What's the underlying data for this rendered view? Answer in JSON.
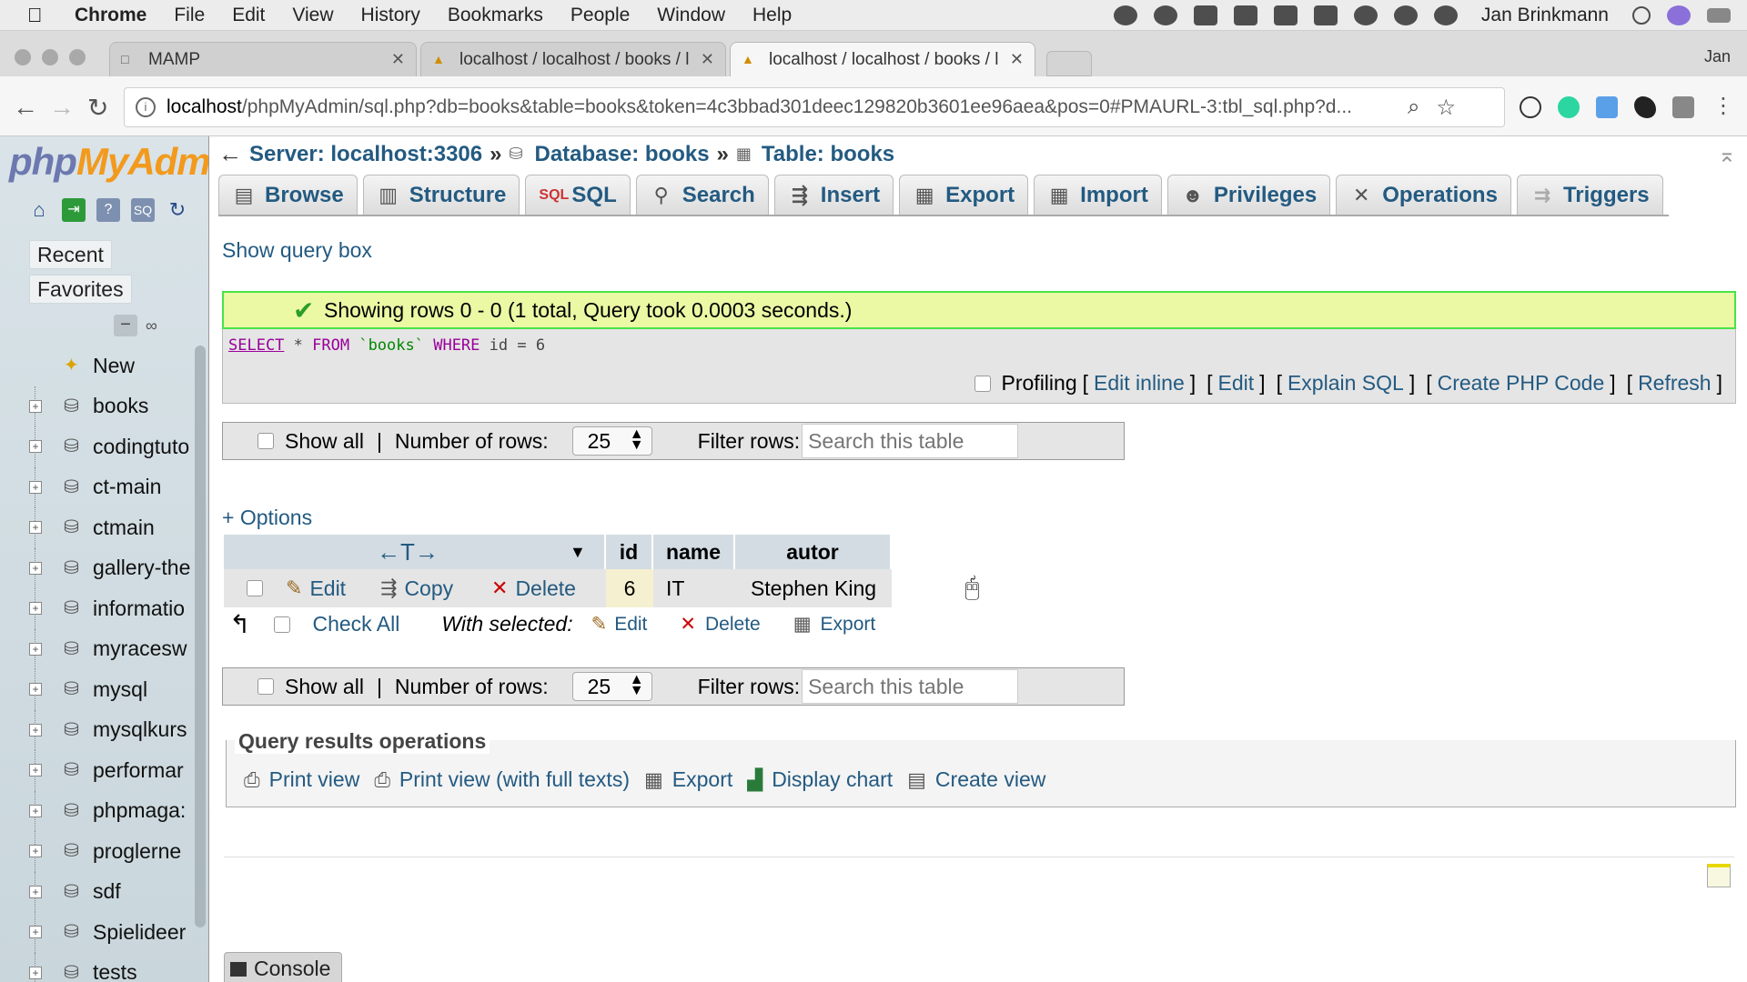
{
  "menubar": {
    "apple": "",
    "items": [
      "Chrome",
      "File",
      "Edit",
      "View",
      "History",
      "Bookmarks",
      "People",
      "Window",
      "Help"
    ],
    "user": "Jan Brinkmann"
  },
  "browser": {
    "tabs": [
      {
        "title": "MAMP",
        "active": false
      },
      {
        "title": "localhost / localhost / books / l",
        "active": false
      },
      {
        "title": "localhost / localhost / books / l",
        "active": true
      }
    ],
    "profile": "Jan",
    "url_host": "localhost",
    "url_path": "/phpMyAdmin/sql.php?db=books&table=books&token=4c3bbad301deec129820b3601ee96aea&pos=0#PMAURL-3:tbl_sql.php?d..."
  },
  "sidebar": {
    "logo_php": "php",
    "logo_my": "MyAdmi",
    "recent_label": "Recent",
    "favorites_label": "Favorites",
    "new_label": "New",
    "databases": [
      "books",
      "codingtuto",
      "ct-main",
      "ctmain",
      "gallery-the",
      "informatio",
      "myracesw",
      "mysql",
      "mysqlkurs",
      "performar",
      "phpmaga:",
      "proglerne",
      "sdf",
      "Spielideer",
      "tests"
    ]
  },
  "breadcrumb": {
    "server": "Server: localhost:3306",
    "database": "Database: books",
    "table": "Table: books",
    "sep": "»"
  },
  "tabs": [
    {
      "label": "Browse",
      "icon": "browse-icon"
    },
    {
      "label": "Structure",
      "icon": "structure-icon"
    },
    {
      "label": "SQL",
      "icon": "sql-icon"
    },
    {
      "label": "Search",
      "icon": "search-icon"
    },
    {
      "label": "Insert",
      "icon": "insert-icon"
    },
    {
      "label": "Export",
      "icon": "export-icon"
    },
    {
      "label": "Import",
      "icon": "import-icon"
    },
    {
      "label": "Privileges",
      "icon": "privileges-icon"
    },
    {
      "label": "Operations",
      "icon": "operations-icon"
    },
    {
      "label": "Triggers",
      "icon": "triggers-icon"
    }
  ],
  "query": {
    "show_query_box": "Show query box",
    "success_message": "Showing rows 0 - 0 (1 total, Query took 0.0003 seconds.)",
    "sql_select": "SELECT",
    "sql_star": " * ",
    "sql_from": "FROM",
    "sql_table": " `books` ",
    "sql_where": "WHERE",
    "sql_condition": " id = 6",
    "profiling": "Profiling",
    "actions": [
      "Edit inline",
      "Edit",
      "Explain SQL",
      "Create PHP Code",
      "Refresh"
    ]
  },
  "navigation": {
    "show_all": "Show all",
    "pipe": "|",
    "rows_label": "Number of rows:",
    "rows_value": "25",
    "filter_label": "Filter rows:",
    "filter_placeholder": "Search this table"
  },
  "results": {
    "options_link": "+ Options",
    "sort_arrows": "←T→",
    "columns": [
      "id",
      "name",
      "autor"
    ],
    "row": {
      "edit": "Edit",
      "copy": "Copy",
      "delete": "Delete",
      "id": "6",
      "name": "IT",
      "autor": "Stephen King"
    },
    "check_all": "Check All",
    "with_selected": "With selected:",
    "bulk_edit": "Edit",
    "bulk_delete": "Delete",
    "bulk_export": "Export"
  },
  "operations": {
    "title": "Query results operations",
    "links": [
      "Print view",
      "Print view (with full texts)",
      "Export",
      "Display chart",
      "Create view"
    ]
  },
  "console": {
    "label": "Console"
  },
  "colors": {
    "link": "#235a81",
    "success_bg": "#ebf8a4",
    "success_border": "#48e348",
    "header_bg": "#d3dce3"
  }
}
